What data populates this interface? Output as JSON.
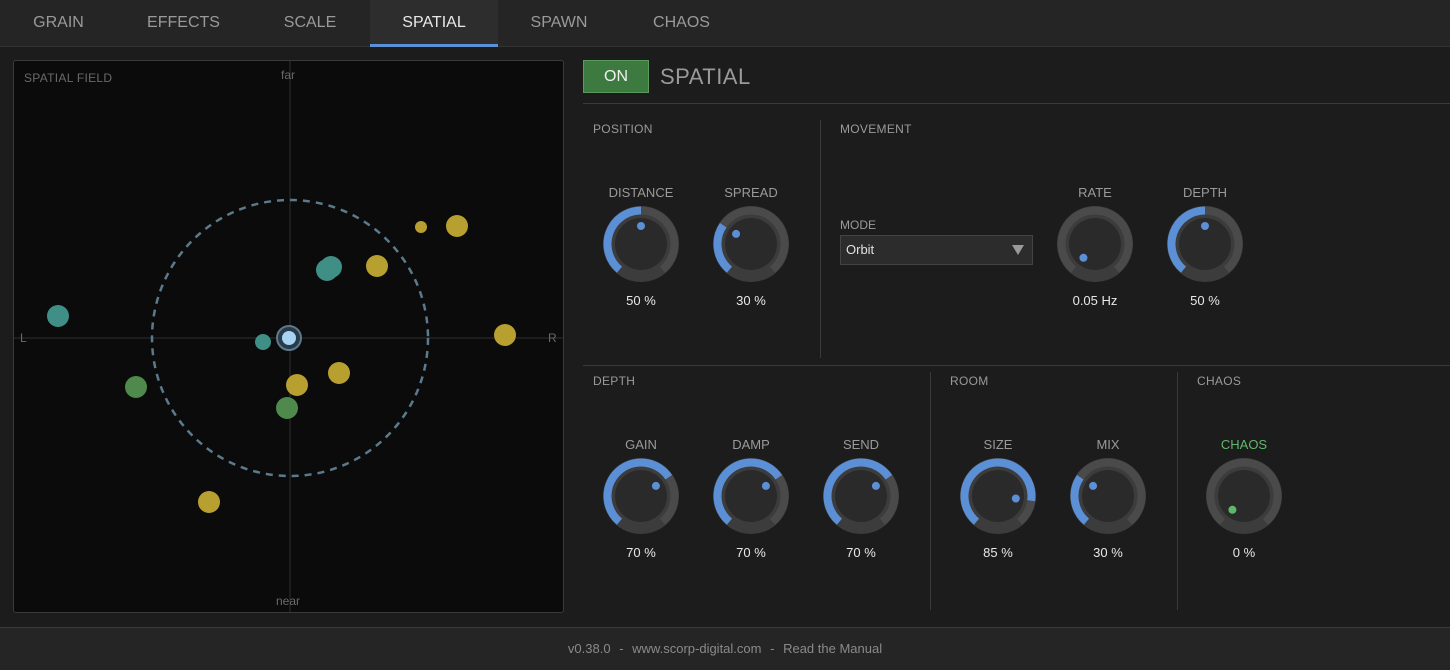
{
  "tabs": [
    {
      "label": "GRAIN",
      "active": false
    },
    {
      "label": "EFFECTS",
      "active": false
    },
    {
      "label": "SCALE",
      "active": false
    },
    {
      "label": "SPATIAL",
      "active": true
    },
    {
      "label": "SPAWN",
      "active": false
    },
    {
      "label": "CHAOS",
      "active": false
    }
  ],
  "field": {
    "title": "SPATIAL FIELD",
    "label_far": "far",
    "label_near": "near",
    "label_left": "L",
    "label_right": "R"
  },
  "header": {
    "on_label": "ON",
    "title": "SPATIAL"
  },
  "position": {
    "label": "POSITION",
    "distance": {
      "label": "DISTANCE",
      "value": "50 %",
      "level": 0.5
    },
    "spread": {
      "label": "SPREAD",
      "value": "30 %",
      "level": 0.3
    }
  },
  "movement": {
    "label": "MOVEMENT",
    "mode_label": "MODE",
    "mode_value": "Orbit",
    "rate": {
      "label": "RATE",
      "value": "0.05 Hz",
      "level": 0.0
    },
    "depth": {
      "label": "DEPTH",
      "value": "50 %",
      "level": 0.5
    }
  },
  "depth": {
    "label": "DEPTH",
    "gain": {
      "label": "GAIN",
      "value": "70 %",
      "level": 0.7
    },
    "damp": {
      "label": "DAMP",
      "value": "70 %",
      "level": 0.7
    },
    "send": {
      "label": "SEND",
      "value": "70 %",
      "level": 0.7
    }
  },
  "room": {
    "label": "ROOM",
    "size": {
      "label": "SIZE",
      "value": "85 %",
      "level": 0.85
    },
    "mix": {
      "label": "MIX",
      "value": "30 %",
      "level": 0.3
    }
  },
  "chaos": {
    "label": "CHAOS",
    "chaos": {
      "label": "CHAOS",
      "value": "0 %",
      "level": 0.0
    }
  },
  "footer": {
    "version": "v0.38.0",
    "separator": "-",
    "website": "www.scorp-digital.com",
    "manual": "Read the Manual"
  },
  "colors": {
    "accent": "#5b8fd6",
    "on_green": "#3d7a3f",
    "chaos_green": "#5fb86a",
    "grain_gold": "#b8a030",
    "grain_teal": "#3f8f86",
    "grain_green": "#4f8a4c",
    "listener": "#a8d4f4"
  }
}
